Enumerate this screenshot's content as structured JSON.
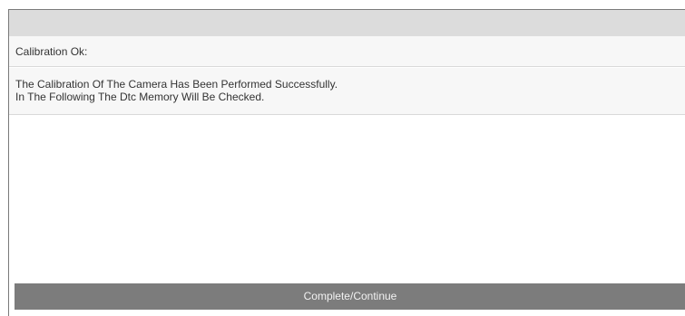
{
  "dialog": {
    "title": "Calibration Ok:",
    "message_line_1": "The Calibration Of The Camera Has Been Performed Successfully.",
    "message_line_2": "In The Following The Dtc Memory Will Be Checked."
  },
  "actions": {
    "continue_label": "Complete/Continue"
  },
  "colors": {
    "header_bar": "#dcdcdc",
    "row_background": "#f7f7f7",
    "button_background": "#7c7c7c",
    "button_text": "#f2f2f2"
  }
}
